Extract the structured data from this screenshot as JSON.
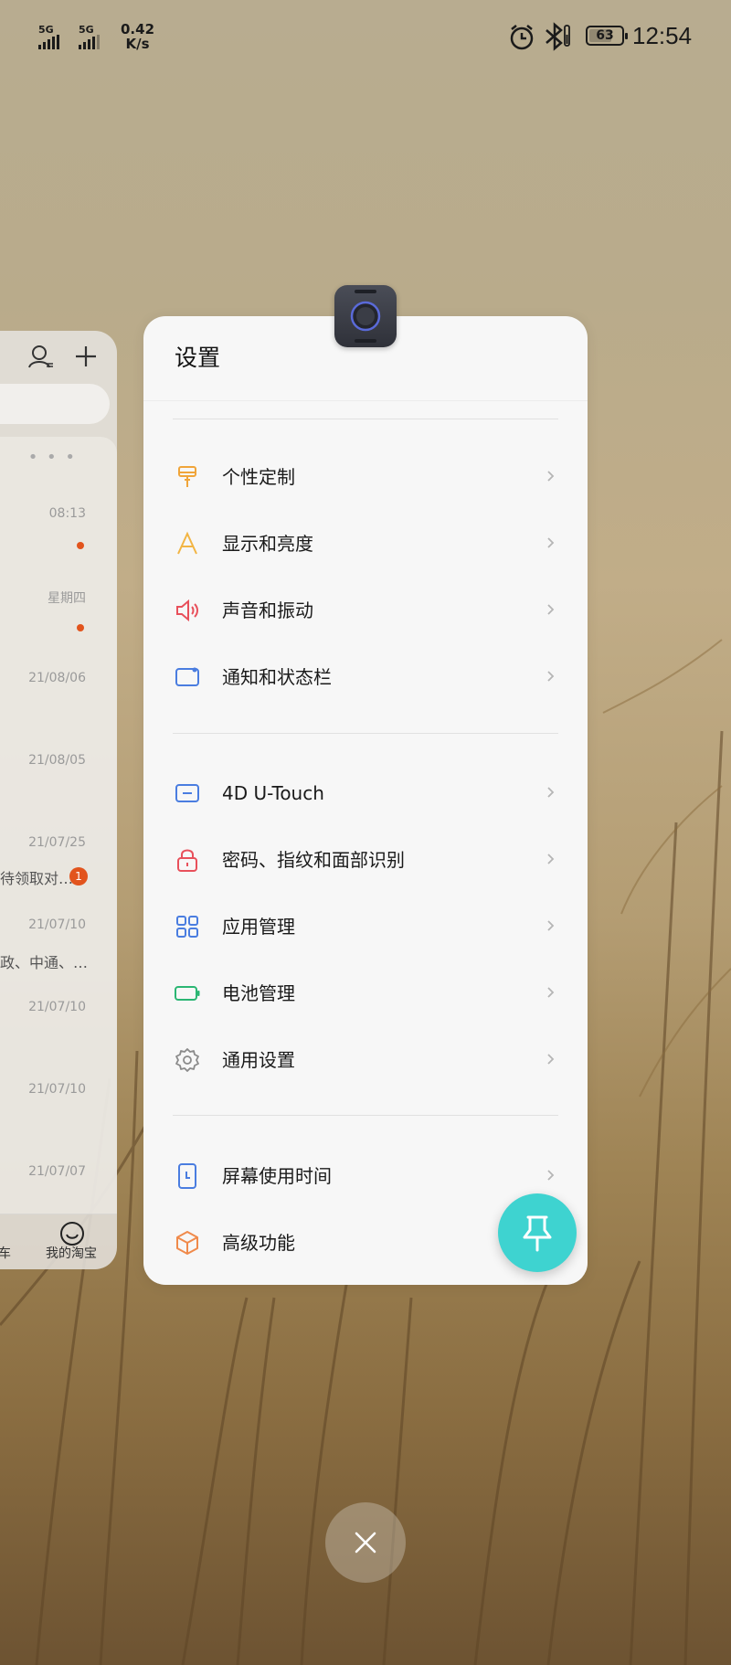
{
  "status_bar": {
    "sim1_label": "5G",
    "sim2_label": "5G",
    "net_speed_value": "0.42",
    "net_speed_unit": "K/s",
    "battery": "63",
    "time": "12:54"
  },
  "background_app": {
    "list_times": [
      "08:13",
      "星期四",
      "21/08/06",
      "21/08/05",
      "21/07/25",
      "21/07/10",
      "21/07/10",
      "21/07/10",
      "21/07/07"
    ],
    "snippets": [
      "待领取对…",
      "政、中通、…"
    ],
    "badge": "1",
    "tab_partial": "车",
    "tab_my_taobao": "我的淘宝"
  },
  "settings_card": {
    "title": "设置",
    "groups": [
      [
        {
          "label": "个性定制",
          "icon": "brush-icon",
          "color": "#f0a53a"
        },
        {
          "label": "显示和亮度",
          "icon": "display-brightness-icon",
          "color": "#f2b544"
        },
        {
          "label": "声音和振动",
          "icon": "speaker-icon",
          "color": "#e8505b"
        },
        {
          "label": "通知和状态栏",
          "icon": "notification-icon",
          "color": "#4a7de0"
        }
      ],
      [
        {
          "label": "4D U-Touch",
          "icon": "utouch-icon",
          "color": "#4a7de0"
        },
        {
          "label": "密码、指纹和面部识别",
          "icon": "lock-icon",
          "color": "#e8505b"
        },
        {
          "label": "应用管理",
          "icon": "apps-grid-icon",
          "color": "#4a7de0"
        },
        {
          "label": "电池管理",
          "icon": "battery-icon",
          "color": "#2bb673"
        },
        {
          "label": "通用设置",
          "icon": "gear-icon",
          "color": "#8a8a8a"
        }
      ],
      [
        {
          "label": "屏幕使用时间",
          "icon": "screen-time-icon",
          "color": "#4a7de0"
        },
        {
          "label": "高级功能",
          "icon": "cube-icon",
          "color": "#f08a4b"
        }
      ]
    ]
  },
  "colors": {
    "pin_button": "#3ed3d0",
    "accent_orange": "#e2541d"
  }
}
